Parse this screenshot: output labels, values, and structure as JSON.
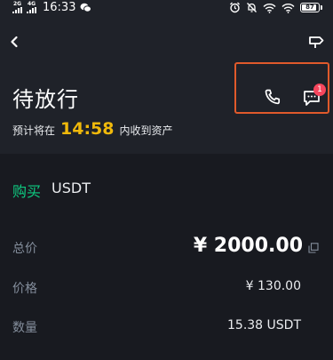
{
  "status_bar": {
    "network_1": "2G",
    "network_2": "4G",
    "time": "16:33",
    "battery": "87"
  },
  "header": {
    "back_icon": "chevron-left-icon",
    "signpost_icon": "signpost-icon"
  },
  "order": {
    "status_title": "待放行",
    "subtitle_prefix": "预计将在",
    "countdown": "14:58",
    "subtitle_suffix": "内收到资产"
  },
  "contact": {
    "phone_icon": "phone-icon",
    "chat_icon": "chat-icon",
    "chat_badge": "1"
  },
  "trade": {
    "side": "购买",
    "asset": "USDT"
  },
  "details": {
    "total_label": "总价",
    "total_value": "¥ 2000.00",
    "price_label": "价格",
    "price_value": "¥ 130.00",
    "qty_label": "数量",
    "qty_value": "15.38 USDT"
  },
  "colors": {
    "accent_yellow": "#f0b90b",
    "buy_green": "#0ecb81",
    "badge_red": "#f6465d",
    "highlight_orange": "#e05a2b"
  }
}
